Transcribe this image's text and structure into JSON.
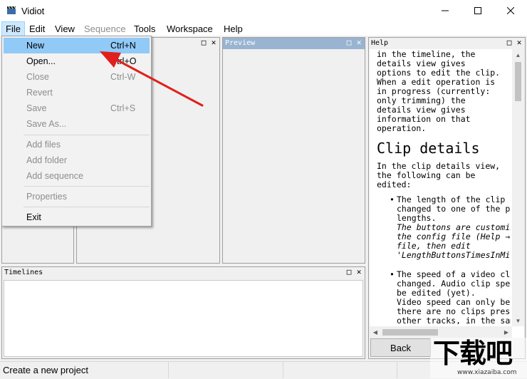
{
  "window": {
    "title": "Vidiot",
    "minimize_glyph": "—",
    "maximize_glyph": "☐",
    "close_glyph": "✕"
  },
  "menu": [
    {
      "label": "File",
      "disabled": false,
      "active": true
    },
    {
      "label": "Edit",
      "disabled": false
    },
    {
      "label": "View",
      "disabled": false
    },
    {
      "label": "Sequence",
      "disabled": true
    },
    {
      "label": "Tools",
      "disabled": false
    },
    {
      "label": "Workspace",
      "disabled": false
    },
    {
      "label": "Help",
      "disabled": false
    }
  ],
  "file_menu": {
    "items": [
      {
        "label": "New",
        "shortcut": "Ctrl+N",
        "disabled": false,
        "highlighted": true
      },
      {
        "label": "Open...",
        "shortcut": "Ctrl+O",
        "disabled": false
      },
      {
        "label": "Close",
        "shortcut": "Ctrl-W",
        "disabled": true
      },
      {
        "label": "Revert",
        "shortcut": "",
        "disabled": true
      },
      {
        "label": "Save",
        "shortcut": "Ctrl+S",
        "disabled": true
      },
      {
        "label": "Save As...",
        "shortcut": "",
        "disabled": true
      },
      {
        "label": "Add files",
        "shortcut": "",
        "disabled": true
      },
      {
        "label": "Add folder",
        "shortcut": "",
        "disabled": true
      },
      {
        "label": "Add sequence",
        "shortcut": "",
        "disabled": true
      },
      {
        "label": "Properties",
        "shortcut": "",
        "disabled": true
      },
      {
        "label": "Exit",
        "shortcut": "",
        "disabled": false
      }
    ]
  },
  "panels": {
    "preview_title": "Preview",
    "timelines_title": "Timelines",
    "help_title": "Help",
    "restore_glyph": "□",
    "close_glyph": "✕"
  },
  "help": {
    "intro_lines": [
      "in the timeline, the",
      "details view gives",
      "options to edit the clip.",
      "When a edit operation is",
      "in progress (currently:",
      "only trimming) the",
      "details view gives",
      "information on that",
      "operation."
    ],
    "heading": "Clip details",
    "para_lines": [
      "In the clip details view,",
      "the following can be",
      "edited:"
    ],
    "bullet1_lines": [
      "The length of the clip c",
      "changed to one of the pr",
      "lengths."
    ],
    "bullet1_italic_lines": [
      "The buttons are customiz",
      "the config file (Help →",
      "file, then edit",
      "'LengthButtonsTimesInMil"
    ],
    "bullet2_lines": [
      "The speed of a video cli",
      "changed. Audio clip spee",
      "be edited (yet).",
      "Video speed can only be",
      "there are no clips prese",
      "other tracks, in the sam"
    ],
    "back_button": "Back"
  },
  "status": {
    "text": "Create a new project"
  },
  "watermark": {
    "text": "下载吧",
    "url_text": "www.xiazaiba.com"
  },
  "colors": {
    "accent_highlight": "#91c9f7",
    "arrow": "#e0201c",
    "active_header": "#99b4d1"
  }
}
